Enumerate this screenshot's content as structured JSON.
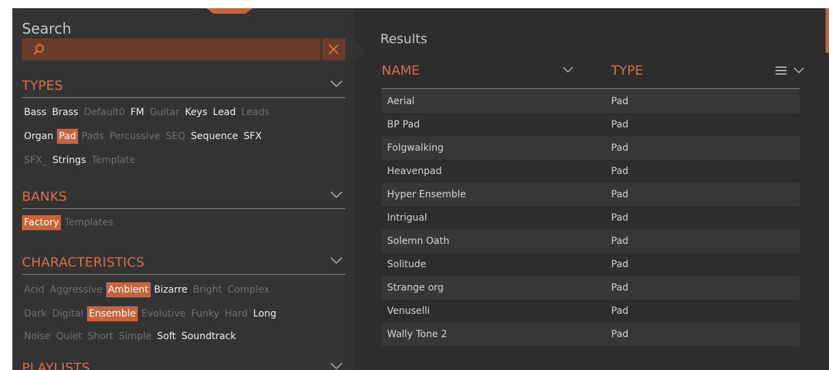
{
  "search": {
    "title": "Search",
    "query": "",
    "placeholder": ""
  },
  "sections": {
    "types": {
      "title": "TYPES",
      "tags": [
        {
          "label": "Bass",
          "state": "on"
        },
        {
          "label": "Brass",
          "state": "on"
        },
        {
          "label": "Default0",
          "state": "off"
        },
        {
          "label": "FM",
          "state": "on"
        },
        {
          "label": "Guitar",
          "state": "off"
        },
        {
          "label": "Keys",
          "state": "on"
        },
        {
          "label": "Lead",
          "state": "on"
        },
        {
          "label": "Leads",
          "state": "off"
        },
        {
          "label": "Organ",
          "state": "on"
        },
        {
          "label": "Pad",
          "state": "selected"
        },
        {
          "label": "Pads",
          "state": "off"
        },
        {
          "label": "Percussive",
          "state": "off"
        },
        {
          "label": "SEQ",
          "state": "off"
        },
        {
          "label": "Sequence",
          "state": "on"
        },
        {
          "label": "SFX",
          "state": "on"
        },
        {
          "label": "SFX_",
          "state": "off"
        },
        {
          "label": "Strings",
          "state": "on"
        },
        {
          "label": "Template",
          "state": "off"
        }
      ]
    },
    "banks": {
      "title": "BANKS",
      "tags": [
        {
          "label": "Factory",
          "state": "selected"
        },
        {
          "label": "Templates",
          "state": "off"
        }
      ]
    },
    "characteristics": {
      "title": "CHARACTERISTICS",
      "tags": [
        {
          "label": "Acid",
          "state": "off"
        },
        {
          "label": "Aggressive",
          "state": "off"
        },
        {
          "label": "Ambient",
          "state": "selected"
        },
        {
          "label": "Bizarre",
          "state": "on"
        },
        {
          "label": "Bright",
          "state": "off"
        },
        {
          "label": "Complex",
          "state": "off"
        },
        {
          "label": "Dark",
          "state": "off"
        },
        {
          "label": "Digital",
          "state": "off"
        },
        {
          "label": "Ensemble",
          "state": "selected"
        },
        {
          "label": "Evolutive",
          "state": "off"
        },
        {
          "label": "Funky",
          "state": "off"
        },
        {
          "label": "Hard",
          "state": "off"
        },
        {
          "label": "Long",
          "state": "on"
        },
        {
          "label": "Noise",
          "state": "off"
        },
        {
          "label": "Quiet",
          "state": "off"
        },
        {
          "label": "Short",
          "state": "off"
        },
        {
          "label": "Simple",
          "state": "off"
        },
        {
          "label": "Soft",
          "state": "on"
        },
        {
          "label": "Soundtrack",
          "state": "on"
        }
      ]
    },
    "playlists": {
      "title": "PLAYLISTS"
    }
  },
  "results": {
    "title": "Results",
    "columns": {
      "name": "NAME",
      "type": "TYPE"
    },
    "rows": [
      {
        "name": "Aerial",
        "type": "Pad"
      },
      {
        "name": "BP Pad",
        "type": "Pad"
      },
      {
        "name": "Folgwalking",
        "type": "Pad"
      },
      {
        "name": "Heavenpad",
        "type": "Pad"
      },
      {
        "name": "Hyper Ensemble",
        "type": "Pad"
      },
      {
        "name": "Intrigual",
        "type": "Pad"
      },
      {
        "name": "Solemn Oath",
        "type": "Pad"
      },
      {
        "name": "Solitude",
        "type": "Pad"
      },
      {
        "name": "Strange org",
        "type": "Pad"
      },
      {
        "name": "Venuselli",
        "type": "Pad"
      },
      {
        "name": "Wally Tone 2",
        "type": "Pad"
      }
    ]
  },
  "colors": {
    "accent": "#c8643c",
    "accent_text": "#d8704a",
    "panel": "#333333",
    "results_panel": "#2d2d2d",
    "tag_active": "#f0f0f0",
    "tag_inactive": "#6f6f6f"
  },
  "icons": {
    "search": "search-icon",
    "clear": "close-icon",
    "collapse": "chevron-down-icon",
    "column_menu": "hamburger-menu-icon"
  }
}
